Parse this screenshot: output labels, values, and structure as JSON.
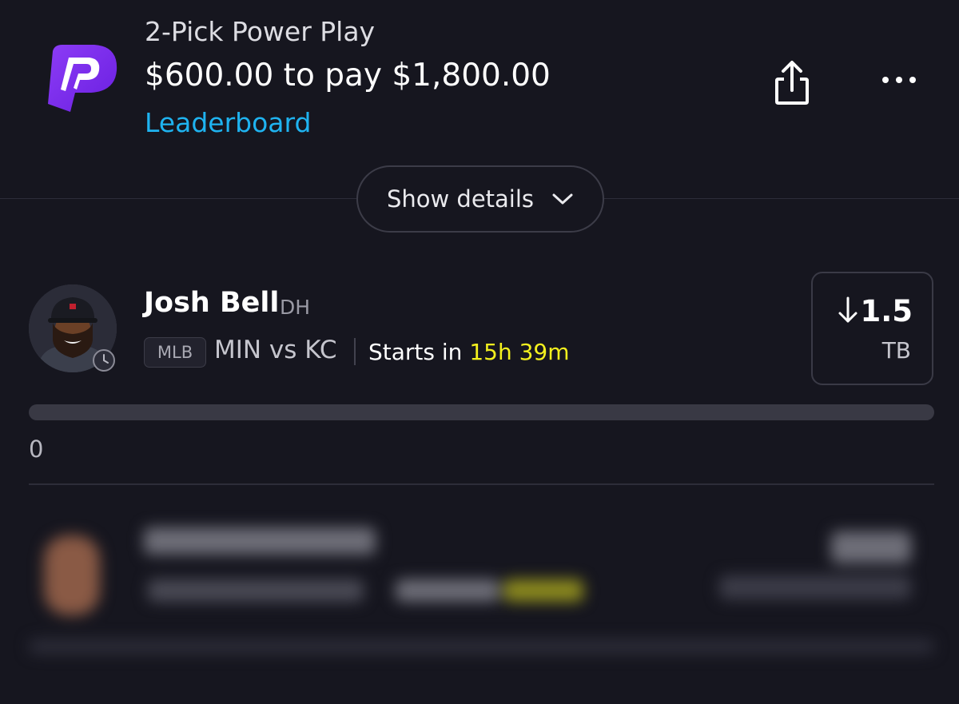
{
  "header": {
    "logo": "prizepicks-logo",
    "title": "2-Pick Power Play",
    "payout": "$600.00 to pay $1,800.00",
    "leaderboard_label": "Leaderboard",
    "share_icon": "share-icon",
    "more_icon": "more-icon"
  },
  "details_toggle": {
    "label": "Show details",
    "icon": "chevron-down-icon"
  },
  "pick": {
    "player_name": "Josh Bell",
    "position": "DH",
    "league": "MLB",
    "matchup": "MIN vs KC",
    "starts_prefix": "Starts in ",
    "starts_time": "15h 39m",
    "direction_icon": "arrow-down-icon",
    "line_value": "1.5",
    "line_stat": "TB",
    "progress_value": "0",
    "progress_fraction": 0
  },
  "colors": {
    "background": "#16161f",
    "accent_link": "#1fb3f0",
    "time_highlight": "#f3f01e",
    "brand_purple": "#7b2ff2"
  }
}
